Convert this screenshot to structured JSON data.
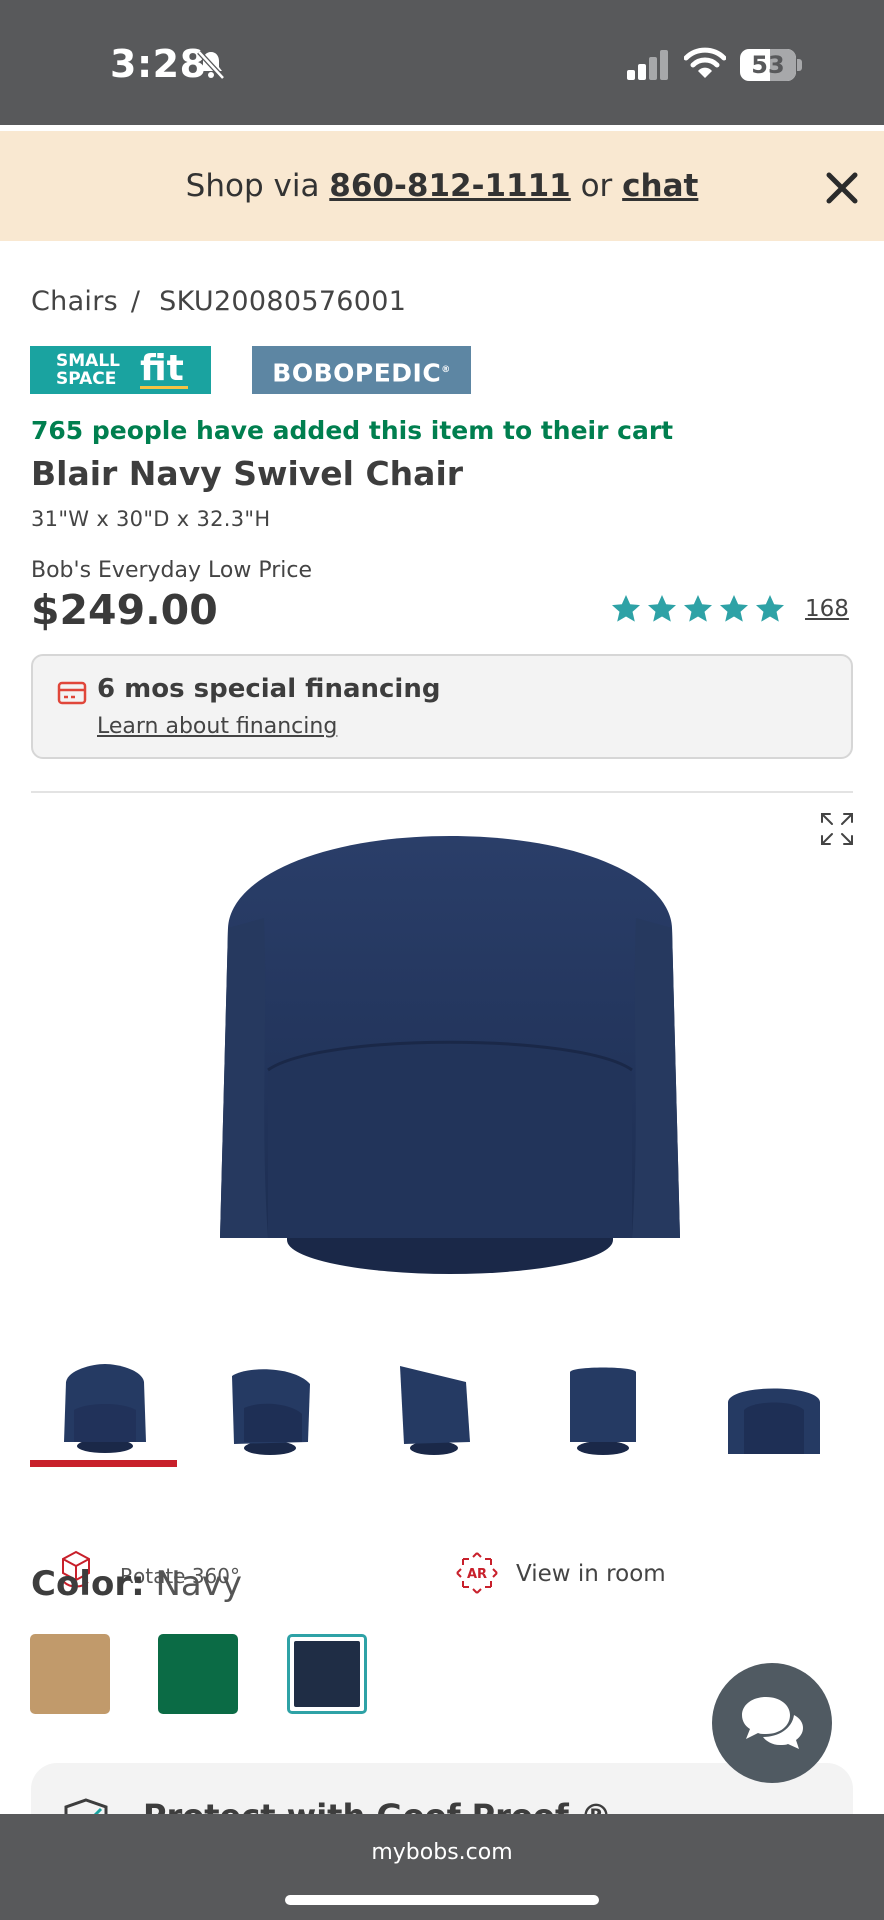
{
  "status_bar": {
    "time": "3:28",
    "battery": "53",
    "battery_level_percent": 53,
    "icons": [
      "bell-slash-icon",
      "signal-icon",
      "wifi-icon",
      "battery-icon"
    ]
  },
  "promo": {
    "prefix": "Shop via ",
    "phone": "860-812-1111",
    "middle": " or ",
    "chat_label": "chat",
    "close_icon": "close-icon"
  },
  "breadcrumb": {
    "category": "Chairs",
    "separator": "/",
    "sku": "SKU20080576001"
  },
  "badges": {
    "small_space_line1": "SMALL",
    "small_space_line2": "SPACE",
    "small_space_fit": "fit",
    "bobopedic": "BOBOPEDIC"
  },
  "product": {
    "cart_notice": "765 people have added this item to their cart",
    "title": "Blair Navy Swivel Chair",
    "dimensions": "31\"W x 30\"D x 32.3\"H",
    "price_label": "Bob's Everyday Low Price",
    "price": "$249.00",
    "rating_stars": 5,
    "review_count": "168"
  },
  "financing": {
    "title": "6 mos special financing",
    "link": "Learn about financing",
    "icon": "credit-card-icon"
  },
  "gallery": {
    "expand_icon": "expand-icon",
    "thumbnails": [
      "front",
      "angle",
      "side",
      "back",
      "top"
    ],
    "selected_index": 0
  },
  "view_options": {
    "rotate_label": "Rotate 360°",
    "view_room_label": "View in room",
    "ar_icon_text": "AR"
  },
  "color": {
    "label": "Color:",
    "value": "Navy",
    "swatches": [
      {
        "name": "Tan",
        "hex": "#c19a6b"
      },
      {
        "name": "Green",
        "hex": "#0b6b45"
      },
      {
        "name": "Navy",
        "hex": "#1f2d45"
      }
    ],
    "selected_index": 2
  },
  "protect": {
    "title": "Protect with Goof Proof ®"
  },
  "browser": {
    "url": "mybobs.com"
  },
  "colors": {
    "teal": "#1aa3a0",
    "green_notice": "#007f4f",
    "accent_red": "#c8202b",
    "star_teal": "#2ea2a6",
    "promo_bg": "#f9e8d1",
    "chrome_gray": "#58595b"
  }
}
